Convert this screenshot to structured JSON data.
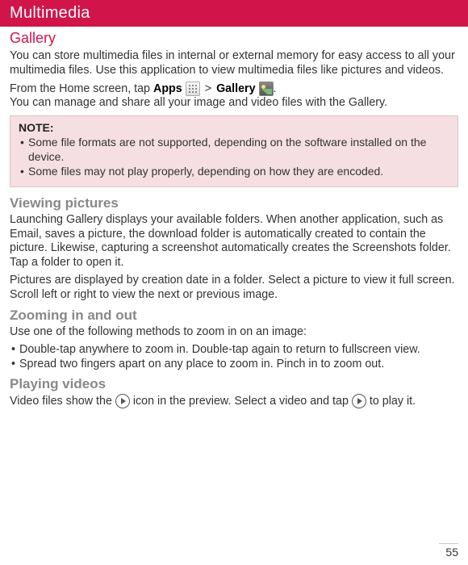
{
  "header": {
    "title": "Multimedia"
  },
  "gallery": {
    "title": "Gallery",
    "intro": "You can store multimedia files in internal or external memory for easy access to all your multimedia files. Use this application to view multimedia files like pictures and videos.",
    "from_home_prefix": "From the Home screen, tap ",
    "apps_label": "Apps",
    "gt": ">",
    "gallery_label": "Gallery",
    "period": ".",
    "manage_line": "You can manage and share all your image and video files with the Gallery."
  },
  "note": {
    "title": "NOTE:",
    "items": [
      "Some file formats are not supported, depending on the software installed on the device.",
      "Some files may not play properly, depending on how they are encoded."
    ]
  },
  "viewing": {
    "title": "Viewing pictures",
    "p1": "Launching Gallery displays your available folders. When another application, such as Email, saves a picture, the download folder is automatically created to contain the picture. Likewise, capturing a screenshot automatically creates the Screenshots folder. Tap a folder to open it.",
    "p2": "Pictures are displayed by creation date in a folder. Select a picture to view it full screen. Scroll left or right to view the next or previous image."
  },
  "zoom": {
    "title": "Zooming in and out",
    "intro": "Use one of the following methods to zoom in on an image:",
    "items": [
      "Double-tap anywhere to zoom in. Double-tap again to return to fullscreen view.",
      "Spread two fingers apart on any place to zoom in. Pinch in to zoom out."
    ]
  },
  "videos": {
    "title": "Playing videos",
    "prefix": "Video files show the ",
    "mid": " icon in the preview. Select a video and tap ",
    "suffix": " to play it."
  },
  "page_number": "55"
}
